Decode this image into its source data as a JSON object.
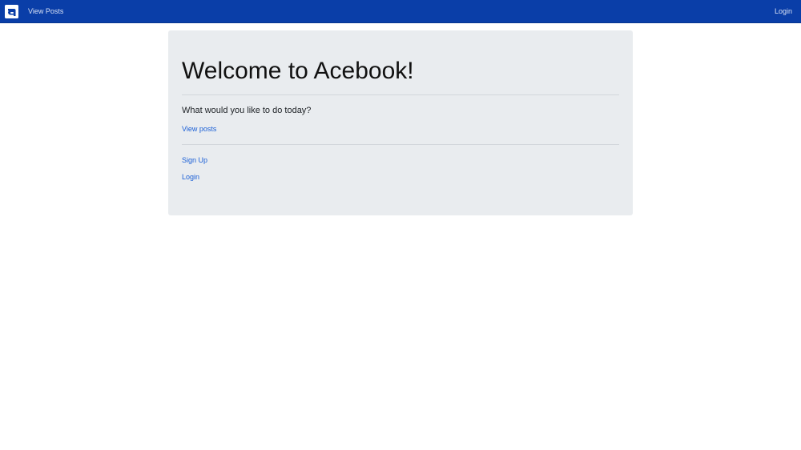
{
  "navbar": {
    "logo_icon": "acebook-logo-icon",
    "view_posts_label": "View Posts",
    "login_label": "Login",
    "background_color": "#0a3ea8"
  },
  "jumbotron": {
    "title": "Welcome to Acebook!",
    "lead": "What would you like to do today?",
    "view_posts_link": "View posts",
    "signup_link": "Sign Up",
    "login_link": "Login",
    "background_color": "#e9ecef",
    "link_color": "#1a5fd6"
  }
}
